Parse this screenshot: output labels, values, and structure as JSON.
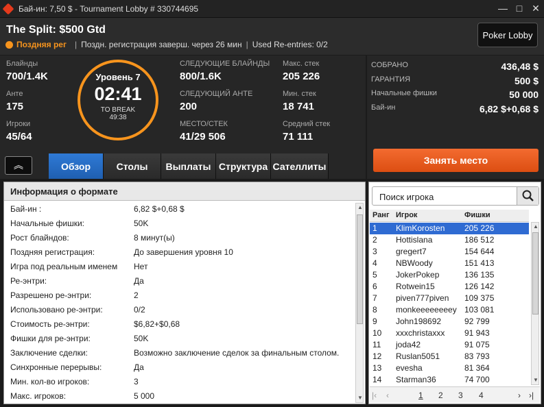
{
  "window": {
    "title": "Бай-ин: 7,50 $ - Tournament Lobby # 330744695",
    "min": "—",
    "max": "□",
    "close": "✕"
  },
  "header": {
    "tournament_name": "The Split: $500 Gtd",
    "status": "Поздняя рег",
    "late_reg_text": "Поздн. регистрация заверш. через 26 мин",
    "reentries_text": "Used Re-entries: 0/2",
    "sep": "|",
    "lobby_button": "Poker Lobby"
  },
  "stats": {
    "blinds_label": "Блайнды",
    "blinds_value": "700/1.4K",
    "ante_label": "Анте",
    "ante_value": "175",
    "players_label": "Игроки",
    "players_value": "45/64",
    "next_blinds_label": "СЛЕДУЮЩИЕ БЛАЙНДЫ",
    "next_blinds_value": "800/1.6K",
    "next_ante_label": "СЛЕДУЮЩИЙ АНТЕ",
    "next_ante_value": "200",
    "place_stack_label": "МЕСТО/СТЕК",
    "place_stack_value": "41/29 506",
    "max_stack_label": "Макс. стек",
    "max_stack_value": "205 226",
    "min_stack_label": "Мин. стек",
    "min_stack_value": "18 741",
    "avg_stack_label": "Средний стек",
    "avg_stack_value": "71 111"
  },
  "clock": {
    "level": "Уровень 7",
    "time": "02:41",
    "break_label": "TO BREAK",
    "break_time": "49:38"
  },
  "tabs": [
    "Обзор",
    "Столы",
    "Выплаты",
    "Структура",
    "Сателлиты"
  ],
  "collapse_icon": "︽",
  "prize": {
    "collected_label": "СОБРАНО",
    "collected_value": "436,48 $",
    "guarantee_label": "ГАРАНТИЯ",
    "guarantee_value": "500 $",
    "start_chips_label": "Начальные фишки",
    "start_chips_value": "50 000",
    "buyin_label": "Бай-ин",
    "buyin_value": "6,82 $+0,68 $",
    "seat_button": "Занять место"
  },
  "format": {
    "title": "Информация о формате",
    "rows": [
      {
        "k": "Бай-ин :",
        "v": "6,82 $+0,68 $"
      },
      {
        "k": "Начальные фишки:",
        "v": "50K"
      },
      {
        "k": "Рост блайндов:",
        "v": "8 минут(ы)"
      },
      {
        "k": "Поздняя регистрация:",
        "v": "До завершения уровня 10"
      },
      {
        "k": "Игра под реальным именем",
        "v": "Нет"
      },
      {
        "k": "Ре-энтри:",
        "v": "Да"
      },
      {
        "k": "Разрешено ре-энтри:",
        "v": "2"
      },
      {
        "k": "Использовано ре-энтри:",
        "v": "0/2"
      },
      {
        "k": "Стоимость ре-энтри:",
        "v": "$6,82+$0,68"
      },
      {
        "k": "Фишки для ре-энтри:",
        "v": "50K"
      },
      {
        "k": "Заключение сделки:",
        "v": "Возможно заключение сделок за финальным столом."
      },
      {
        "k": "Синхронные перерывы:",
        "v": "Да"
      },
      {
        "k": "Мин. кол-во игроков:",
        "v": "3"
      },
      {
        "k": "Макс. игроков:",
        "v": "5 000"
      }
    ]
  },
  "players": {
    "search_placeholder": "Поиск игрока",
    "col_rank": "Ранг",
    "col_player": "Игрок",
    "col_chips": "Фишки",
    "rows": [
      {
        "r": "1",
        "n": "KlimKorosten",
        "c": "205 226"
      },
      {
        "r": "2",
        "n": "Hottislana",
        "c": "186 512"
      },
      {
        "r": "3",
        "n": "gregert7",
        "c": "154 644"
      },
      {
        "r": "4",
        "n": "NBWoody",
        "c": "151 413"
      },
      {
        "r": "5",
        "n": "JokerPokep",
        "c": "136 135"
      },
      {
        "r": "6",
        "n": "Rotwein15",
        "c": "126 142"
      },
      {
        "r": "7",
        "n": "piven777piven",
        "c": "109 375"
      },
      {
        "r": "8",
        "n": "monkeeeeeeeey",
        "c": "103 081"
      },
      {
        "r": "9",
        "n": "John198692",
        "c": "92 799"
      },
      {
        "r": "10",
        "n": "xxxchristaxxx",
        "c": "91 943"
      },
      {
        "r": "11",
        "n": "joda42",
        "c": "91 075"
      },
      {
        "r": "12",
        "n": "Ruslan5051",
        "c": "83 793"
      },
      {
        "r": "13",
        "n": "evesha",
        "c": "81 364"
      },
      {
        "r": "14",
        "n": "Starman36",
        "c": "74 700"
      }
    ],
    "pages": [
      "1",
      "2",
      "3",
      "4"
    ],
    "first": "|‹",
    "prev": "‹",
    "next": "›",
    "last": "›|"
  },
  "colors": {
    "accent": "#f7941d",
    "tab_active": "#2f7ad6",
    "seat_button": "#e8581f",
    "selected_row": "#2f6bd2"
  }
}
